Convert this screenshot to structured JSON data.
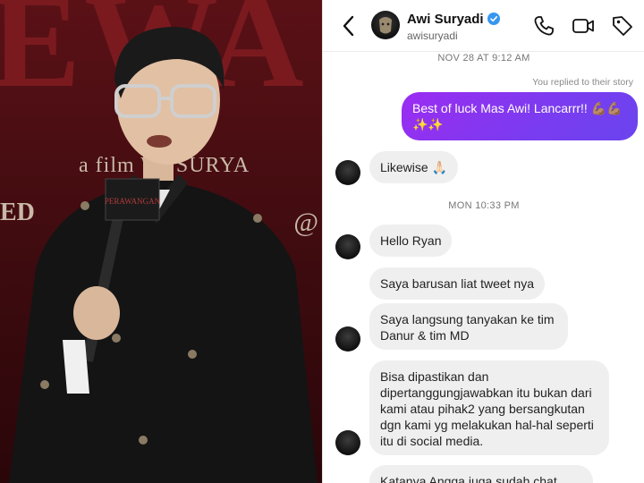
{
  "photo": {
    "backdrop_letters": "EWA",
    "film_credit": "a film WI SURYA",
    "side_left": "ED",
    "side_right": "@",
    "mic_flag_text": "PERAWANGAN"
  },
  "header": {
    "name": "Awi Suryadi",
    "handle": "awisuryadi",
    "icons": [
      "back-icon",
      "phone-icon",
      "video-icon",
      "tag-icon",
      "verified-icon"
    ]
  },
  "chat": {
    "timestamp_1": "NOV 28 AT 9:12 AM",
    "reply_note": "You replied to their story",
    "outgoing_message": "Best of luck Mas Awi! Lancarrr!! 💪🏽💪🏽✨✨",
    "reply_1": "Likewise 🙏🏻",
    "timestamp_2": "MON 10:33 PM",
    "messages": [
      "Hello Ryan",
      "Saya barusan liat tweet nya",
      "Saya langsung tanyakan ke tim Danur & tim MD",
      "Bisa dipastikan dan dipertanggungjawabkan itu bukan dari kami atau pihak2 yang bersangkutan dgn kami yg melakukan hal-hal seperti itu di social media.",
      "Katanya Angga juga sudah chat"
    ]
  },
  "colors": {
    "outgoing_gradient_start": "#9b2cf1",
    "outgoing_gradient_end": "#6a44ee",
    "incoming_bubble": "#efefef",
    "verified_blue": "#3797f0",
    "photo_backdrop": "#5a1116"
  }
}
